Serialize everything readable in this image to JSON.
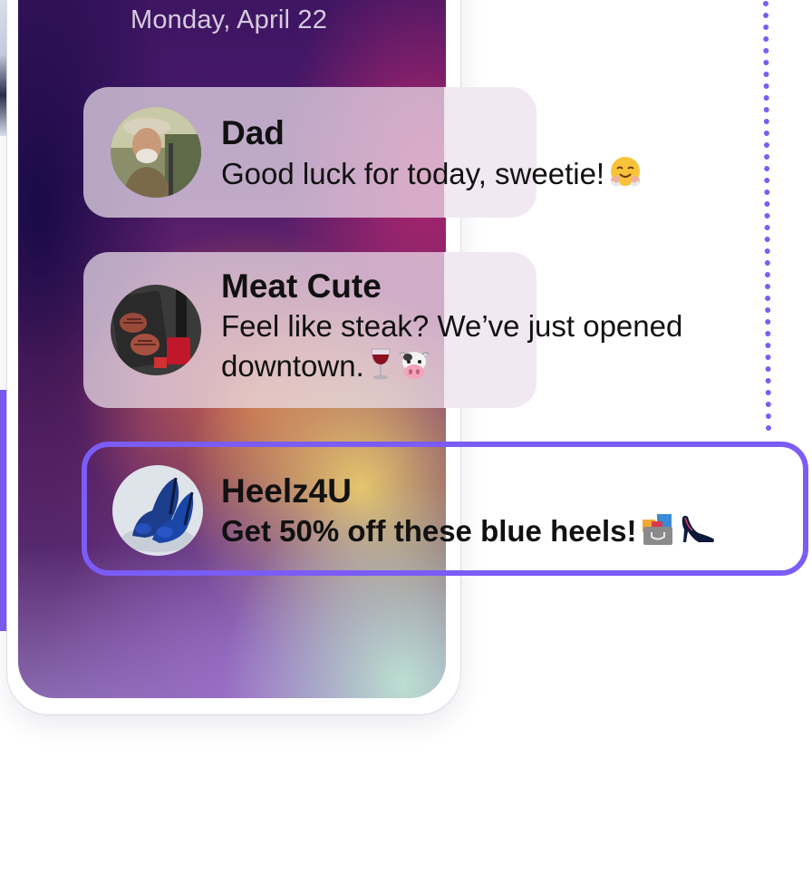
{
  "lock_screen": {
    "date": "Monday, April 22"
  },
  "notifications": [
    {
      "sender": "Dad",
      "message": "Good luck for today, sweetie!",
      "emoji": [
        "smiling-face-with-hearts-icon"
      ],
      "highlighted": false
    },
    {
      "sender": "Meat Cute",
      "message": "Feel like steak? We’ve just opened downtown.",
      "emoji": [
        "wine-glass-icon",
        "cow-face-icon"
      ],
      "highlighted": false
    },
    {
      "sender": "Heelz4U",
      "message": "Get 50% off these blue heels!",
      "emoji": [
        "shopping-bags-icon",
        "high-heel-icon"
      ],
      "highlighted": true
    }
  ],
  "colors": {
    "highlight_border": "#7b5cf5",
    "dotted_line": "#7b5cf5"
  }
}
